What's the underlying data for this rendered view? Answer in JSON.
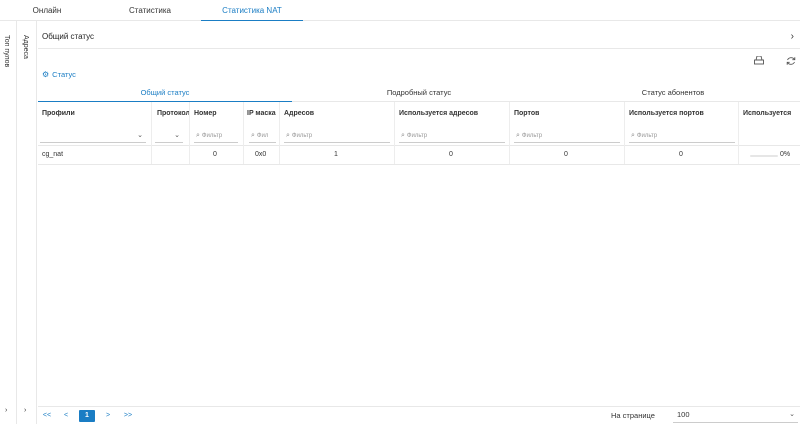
{
  "top_tabs": [
    "Онлайн",
    "Статистика",
    "Статистика NAT"
  ],
  "side": {
    "panel1": "Топ пулов",
    "panel2": "Адреса",
    "arrow": "›"
  },
  "status_section": {
    "title": "Общий статус",
    "chevron": "›"
  },
  "icons": {
    "print": "printer-icon",
    "refresh": "refresh-icon",
    "status": "settings-gear-icon",
    "search": "search-icon"
  },
  "status_link": "Статус",
  "sub_tabs": [
    "Общий статус",
    "Подробный статус",
    "Статус абонентов"
  ],
  "table": {
    "headers": [
      "Профили",
      "Протокол",
      "Номер",
      "IP маска",
      "Адресов",
      "Используется адресов",
      "Портов",
      "Используется портов",
      "Используется"
    ],
    "filter_placeholders": [
      "Фильтр",
      "Фил",
      "Фильтр",
      "Фильтр",
      "Фильтр",
      "Фильтр"
    ],
    "rows": [
      {
        "profile": "cg_nat",
        "protocol": "",
        "number": "0",
        "ip_mask": "0x0",
        "addresses": "1",
        "used_addresses": "0",
        "ports": "0",
        "used_ports": "0",
        "used_pct": "0%",
        "used_fraction": 0
      }
    ]
  },
  "pagination": {
    "first": "<<",
    "prev": "<",
    "current": "1",
    "next": ">",
    "last": ">>",
    "per_page_label": "На странице",
    "per_page_value": "100"
  },
  "colors": {
    "accent": "#1a7dc4",
    "border": "#e8e8e8"
  }
}
